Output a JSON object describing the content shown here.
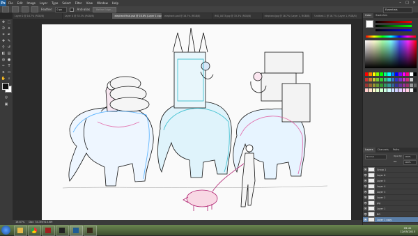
{
  "app": {
    "logo": "Ps"
  },
  "menubar": {
    "items": [
      "File",
      "Edit",
      "Image",
      "Layer",
      "Type",
      "Select",
      "Filter",
      "View",
      "Window",
      "Help"
    ]
  },
  "window_controls": {
    "minimize": "–",
    "maximize": "□",
    "close": "✕"
  },
  "options_bar": {
    "feather_label": "Feather:",
    "feather_value": "0 px",
    "antialias_label": "Anti-alias",
    "refine_label": "Refine Edge...",
    "workspace": "Essentials"
  },
  "doc_tabs": [
    {
      "label": "Layer 0 @ 16.7% (RGB/8)",
      "active": false
    },
    {
      "label": "Layer 0 @ 33.3% (RGB/8)",
      "active": false
    },
    {
      "label": "elephant final.psd @ 16.6% (Layer 1 copy, RGB/8)",
      "active": true
    },
    {
      "label": "elephant.psd @ 16.7% (RGB/8)",
      "active": false
    },
    {
      "label": "IMG_0073.jpg @ 33.3% (RGB/8)",
      "active": false
    },
    {
      "label": "elephant.jpg @ 16.7% (Layer 1, RGB/8)",
      "active": false
    },
    {
      "label": "Untitled-1 @ 16.7% (Layer 1, RGB/8)",
      "active": false
    }
  ],
  "status_bar": {
    "zoom": "16.67%",
    "doc_size": "Doc: 34.3M/315.6M"
  },
  "color_panel": {
    "tabs": [
      "Color",
      "Swatches"
    ]
  },
  "swatch_colors": [
    "#ff0000",
    "#ff8000",
    "#ffff00",
    "#80ff00",
    "#00ff00",
    "#00ff80",
    "#00ffff",
    "#0080ff",
    "#0000ff",
    "#8000ff",
    "#ff00ff",
    "#ff0080",
    "#ffffff",
    "#000000",
    "#cc3333",
    "#cc7a33",
    "#cccc33",
    "#7acc33",
    "#33cc33",
    "#33cc7a",
    "#33cccc",
    "#337acc",
    "#3333cc",
    "#7a33cc",
    "#cc33cc",
    "#cc337a",
    "#cccccc",
    "#333333",
    "#993333",
    "#996633",
    "#999933",
    "#669933",
    "#339933",
    "#339966",
    "#339999",
    "#336699",
    "#333399",
    "#663399",
    "#993399",
    "#993366",
    "#999999",
    "#666666",
    "#ffcccc",
    "#ffe0cc",
    "#ffffcc",
    "#e0ffcc",
    "#ccffcc",
    "#ccffe0",
    "#ccffff",
    "#cce0ff",
    "#ccccff",
    "#e0ccff",
    "#ffccff",
    "#ffcce0",
    "#f2f2f2",
    "#1a1a1a"
  ],
  "layers_panel": {
    "tabs": [
      "Layers",
      "Channels",
      "Paths"
    ],
    "blend_mode": "Normal",
    "opacity_label": "Opacity:",
    "opacity_value": "100%",
    "fill_label": "Fill:",
    "fill_value": "100%",
    "layers": [
      {
        "name": "Group 1",
        "selected": false
      },
      {
        "name": "Layer 6",
        "selected": false
      },
      {
        "name": "Layer 5",
        "selected": false
      },
      {
        "name": "Layer 4",
        "selected": false
      },
      {
        "name": "Layer 3",
        "selected": false
      },
      {
        "name": "Layer 2",
        "selected": false
      },
      {
        "name": "pig",
        "selected": false
      },
      {
        "name": "Layer 1",
        "selected": false
      },
      {
        "name": "BG",
        "selected": false
      },
      {
        "name": "Layer 1 copy",
        "selected": true
      }
    ]
  },
  "taskbar": {
    "time": "09:41",
    "date": "12/05/2013"
  }
}
